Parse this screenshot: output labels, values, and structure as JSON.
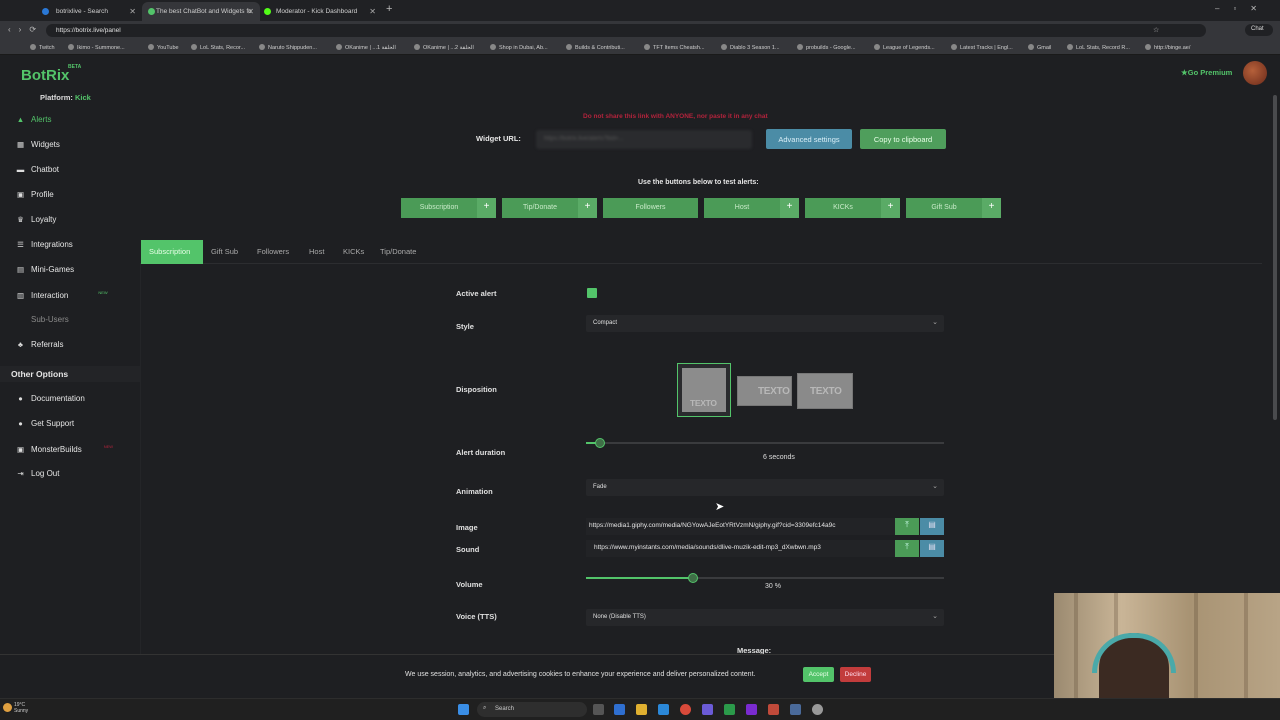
{
  "browser": {
    "tabs": [
      {
        "title": "botrixlive - Search",
        "active": false
      },
      {
        "title": "The best ChatBot and Widgets fo",
        "active": true
      },
      {
        "title": "Moderator - Kick Dashboard",
        "active": false
      }
    ],
    "new_tab_glyph": "+",
    "url": "https://botrix.live/panel",
    "bookmarks": [
      "Twitch",
      "Ikimo - Summone...",
      "YouTube",
      "LoL Stats, Recor...",
      "Naruto Shippuden...",
      "OKanime | ...1 الحلقة",
      "OKanime | ...2 الحلقة",
      "Shop in Dubai, Ab...",
      "Builds & Contributi...",
      "TFT Items Cheatsh...",
      "Diablo 3 Season 1...",
      "probuilds - Google...",
      "League of Legends...",
      "Latest Tracks | Engl...",
      "Gmail",
      "LoL Stats, Record R...",
      "http://binge.ae/"
    ]
  },
  "brand": {
    "logo": "BotRix",
    "badge": "BETA",
    "platform_label": "Platform:",
    "platform_value": "Kick",
    "accent": "#53c46a"
  },
  "nav": {
    "items": [
      {
        "label": "Alerts",
        "icon": "alert-triangle-icon"
      },
      {
        "label": "Widgets",
        "icon": "widgets-icon"
      },
      {
        "label": "Chatbot",
        "icon": "chat-icon"
      },
      {
        "label": "Profile",
        "icon": "profile-icon"
      },
      {
        "label": "Loyalty",
        "icon": "trophy-icon"
      },
      {
        "label": "Integrations",
        "icon": "integrations-icon"
      },
      {
        "label": "Mini-Games",
        "icon": "gamepad-icon"
      },
      {
        "label": "Interaction",
        "icon": "interaction-icon",
        "badge": "NEW"
      },
      {
        "label": "Sub-Users",
        "icon": "users-icon"
      },
      {
        "label": "Referrals",
        "icon": "referrals-icon"
      }
    ],
    "other_title": "Other Options",
    "other_items": [
      {
        "label": "Documentation",
        "icon": "documentation-icon"
      },
      {
        "label": "Get Support",
        "icon": "support-icon"
      },
      {
        "label": "MonsterBuilds",
        "icon": "monster-icon",
        "badge": "NEW"
      },
      {
        "label": "Log Out",
        "icon": "logout-icon"
      }
    ]
  },
  "header": {
    "premium": "Go Premium"
  },
  "widget": {
    "warning": "Do not share this link with ANYONE, nor paste it in any chat",
    "url_label": "Widget URL:",
    "url_value": "https://botrix.live/alerts?bid=...",
    "advanced_label": "Advanced settings",
    "copy_label": "Copy to clipboard"
  },
  "test": {
    "label": "Use the buttons below to test alerts:",
    "buttons": [
      "Subscription",
      "Tip/Donate",
      "Followers",
      "Host",
      "KICKs",
      "Gift Sub"
    ]
  },
  "tabs": [
    "Subscription",
    "Gift Sub",
    "Followers",
    "Host",
    "KICKs",
    "Tip/Donate"
  ],
  "form": {
    "active_label": "Active alert",
    "style_label": "Style",
    "style_value": "Compact",
    "disposition_label": "Disposition",
    "disposition_text": "TEXTO",
    "duration_label": "Alert duration",
    "duration_value": "6 seconds",
    "duration_fraction": 0.04,
    "animation_label": "Animation",
    "animation_value": "Fade",
    "image_label": "Image",
    "image_value": "https://media1.giphy.com/media/NGYowAJeEotYRtVzmN/giphy.gif?cid=3309efc14a9c",
    "sound_label": "Sound",
    "sound_value": "https://www.myinstants.com/media/sounds/dlive-muzik-edit-mp3_dXwbwn.mp3",
    "volume_label": "Volume",
    "volume_value": "30 %",
    "volume_fraction": 0.3,
    "voice_label": "Voice (TTS)",
    "voice_value": "None (Disable TTS)",
    "message_label": "Message:"
  },
  "cookie": {
    "text": "We use session, analytics, and advertising cookies to enhance your experience and deliver personalized content.",
    "accept": "Accept",
    "decline": "Decline"
  },
  "taskbar": {
    "weather_temp": "19°C",
    "weather_desc": "Sunny",
    "search": "Search"
  }
}
